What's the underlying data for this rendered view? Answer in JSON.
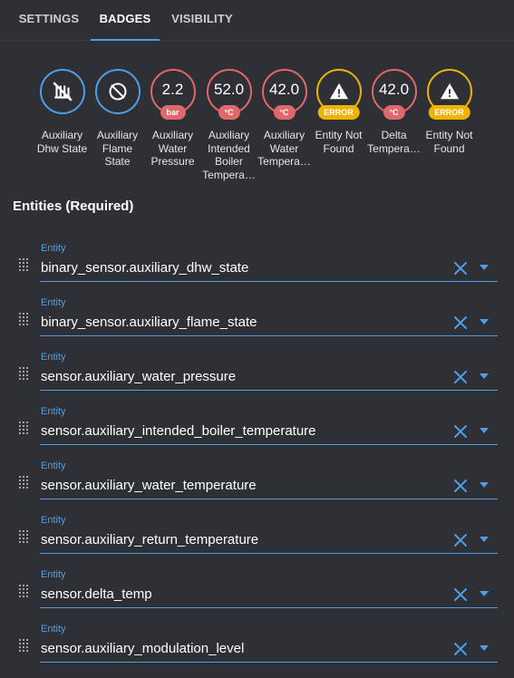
{
  "tabs": [
    {
      "label": "SETTINGS",
      "active": false
    },
    {
      "label": "BADGES",
      "active": true
    },
    {
      "label": "VISIBILITY",
      "active": false
    }
  ],
  "badges": [
    {
      "type": "icon",
      "icon": "radiator-off-icon",
      "color": "#4f9ee8",
      "label": "Auxiliary Dhw State"
    },
    {
      "type": "icon",
      "icon": "fire-off-icon",
      "color": "#4f9ee8",
      "label": "Auxiliary Flame State"
    },
    {
      "type": "value",
      "value": "2.2",
      "unit": "bar",
      "color": "#e0686a",
      "label": "Auxiliary Water Pressure"
    },
    {
      "type": "value",
      "value": "52.0",
      "unit": "°C",
      "color": "#e0686a",
      "label": "Auxiliary Intended Boiler Tempera…"
    },
    {
      "type": "value",
      "value": "42.0",
      "unit": "°C",
      "color": "#e0686a",
      "label": "Auxiliary Water Tempera…"
    },
    {
      "type": "error",
      "icon": "alert-icon",
      "unit": "ERROR",
      "color": "#f0b400",
      "label": "Entity Not Found"
    },
    {
      "type": "value",
      "value": "42.0",
      "unit": "°C",
      "color": "#e0686a",
      "label": "Delta Tempera…"
    },
    {
      "type": "error",
      "icon": "alert-icon",
      "unit": "ERROR",
      "color": "#f0b400",
      "label": "Entity Not Found"
    }
  ],
  "section_title": "Entities (Required)",
  "entities": [
    {
      "label": "Entity",
      "value": "binary_sensor.auxiliary_dhw_state"
    },
    {
      "label": "Entity",
      "value": "binary_sensor.auxiliary_flame_state"
    },
    {
      "label": "Entity",
      "value": "sensor.auxiliary_water_pressure"
    },
    {
      "label": "Entity",
      "value": "sensor.auxiliary_intended_boiler_temperature"
    },
    {
      "label": "Entity",
      "value": "sensor.auxiliary_water_temperature"
    },
    {
      "label": "Entity",
      "value": "sensor.auxiliary_return_temperature"
    },
    {
      "label": "Entity",
      "value": "sensor.delta_temp"
    },
    {
      "label": "Entity",
      "value": "sensor.auxiliary_modulation_level"
    }
  ],
  "colors": {
    "accent": "#4f9ee8",
    "warning": "#f0b400",
    "error": "#e0686a",
    "background": "#2f3035"
  }
}
